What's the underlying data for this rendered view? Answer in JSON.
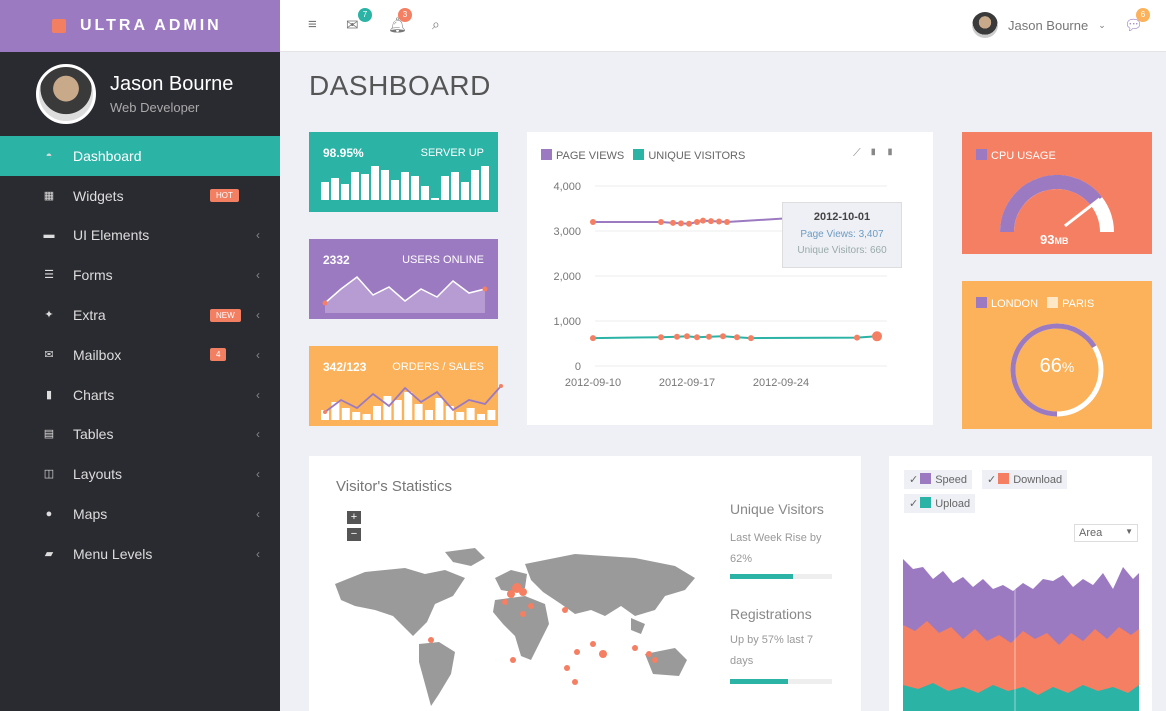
{
  "brand": {
    "name": "ULTRA ADMIN"
  },
  "profile": {
    "name": "Jason Bourne",
    "role": "Web Developer"
  },
  "nav": [
    {
      "label": "Dashboard",
      "icon": "dashboard-icon",
      "active": true
    },
    {
      "label": "Widgets",
      "icon": "grid-icon",
      "badge": "HOT"
    },
    {
      "label": "UI Elements",
      "icon": "briefcase-icon",
      "chev": true
    },
    {
      "label": "Forms",
      "icon": "sliders-icon",
      "chev": true
    },
    {
      "label": "Extra",
      "icon": "gift-icon",
      "badge": "NEW",
      "chev": true
    },
    {
      "label": "Mailbox",
      "icon": "envelope-icon",
      "badge": "4",
      "chev": true
    },
    {
      "label": "Charts",
      "icon": "bar-chart-icon",
      "chev": true
    },
    {
      "label": "Tables",
      "icon": "table-icon",
      "chev": true
    },
    {
      "label": "Layouts",
      "icon": "columns-icon",
      "chev": true
    },
    {
      "label": "Maps",
      "icon": "map-marker-icon",
      "chev": true
    },
    {
      "label": "Menu Levels",
      "icon": "folder-icon",
      "chev": true
    }
  ],
  "topbar": {
    "mail_count": "7",
    "notif_count": "3",
    "chat_count": "6",
    "user_name": "Jason Bourne"
  },
  "page_title": "DASHBOARD",
  "stats": {
    "server": {
      "value": "98.95%",
      "label": "SERVER UP"
    },
    "users": {
      "value": "2332",
      "label": "USERS ONLINE"
    },
    "orders": {
      "value": "342/123",
      "label": "ORDERS / SALES"
    }
  },
  "colors": {
    "teal": "#2bb3a6",
    "purple": "#9c7ac1",
    "orange": "#fbb25a",
    "coral": "#f57f62",
    "dark": "#2a2b30"
  },
  "chart_data": [
    {
      "type": "line",
      "legend": [
        "PAGE VIEWS",
        "UNIQUE VISITORS"
      ],
      "x_ticks": [
        "2012-09-10",
        "2012-09-17",
        "2012-09-24"
      ],
      "y_ticks": [
        "4,000",
        "3,000",
        "2,000",
        "1,000",
        "0"
      ],
      "ylim": [
        0,
        4000
      ],
      "series": [
        {
          "name": "PAGE VIEWS",
          "values": [
            3200,
            3200,
            3180,
            3170,
            3160,
            3200,
            3230,
            3220,
            3210,
            3200,
            3407
          ]
        },
        {
          "name": "UNIQUE VISITORS",
          "values": [
            620,
            640,
            650,
            660,
            640,
            650,
            660,
            640,
            620,
            630,
            660
          ]
        }
      ],
      "tooltip": {
        "date": "2012-10-01",
        "page_views": "Page Views: 3,407",
        "visitors": "Unique Visitors: 660"
      }
    }
  ],
  "cpu": {
    "label": "CPU USAGE",
    "value": "93",
    "unit": "MB",
    "fraction": 0.93
  },
  "city": {
    "legend": [
      "LONDON",
      "PARIS"
    ],
    "value": "66",
    "unit": "%",
    "fraction": 0.66
  },
  "visitors": {
    "title": "Visitor's Statistics",
    "unique_title": "Unique Visitors",
    "unique_sub": "Last Week Rise by 62%",
    "unique_fraction": 0.62,
    "reg_title": "Registrations",
    "reg_sub": "Up by 57% last 7 days",
    "reg_fraction": 0.57,
    "zoom_in": "+",
    "zoom_out": "−"
  },
  "area_chart": {
    "legend": [
      "Speed",
      "Download",
      "Upload"
    ],
    "select": "Area"
  }
}
